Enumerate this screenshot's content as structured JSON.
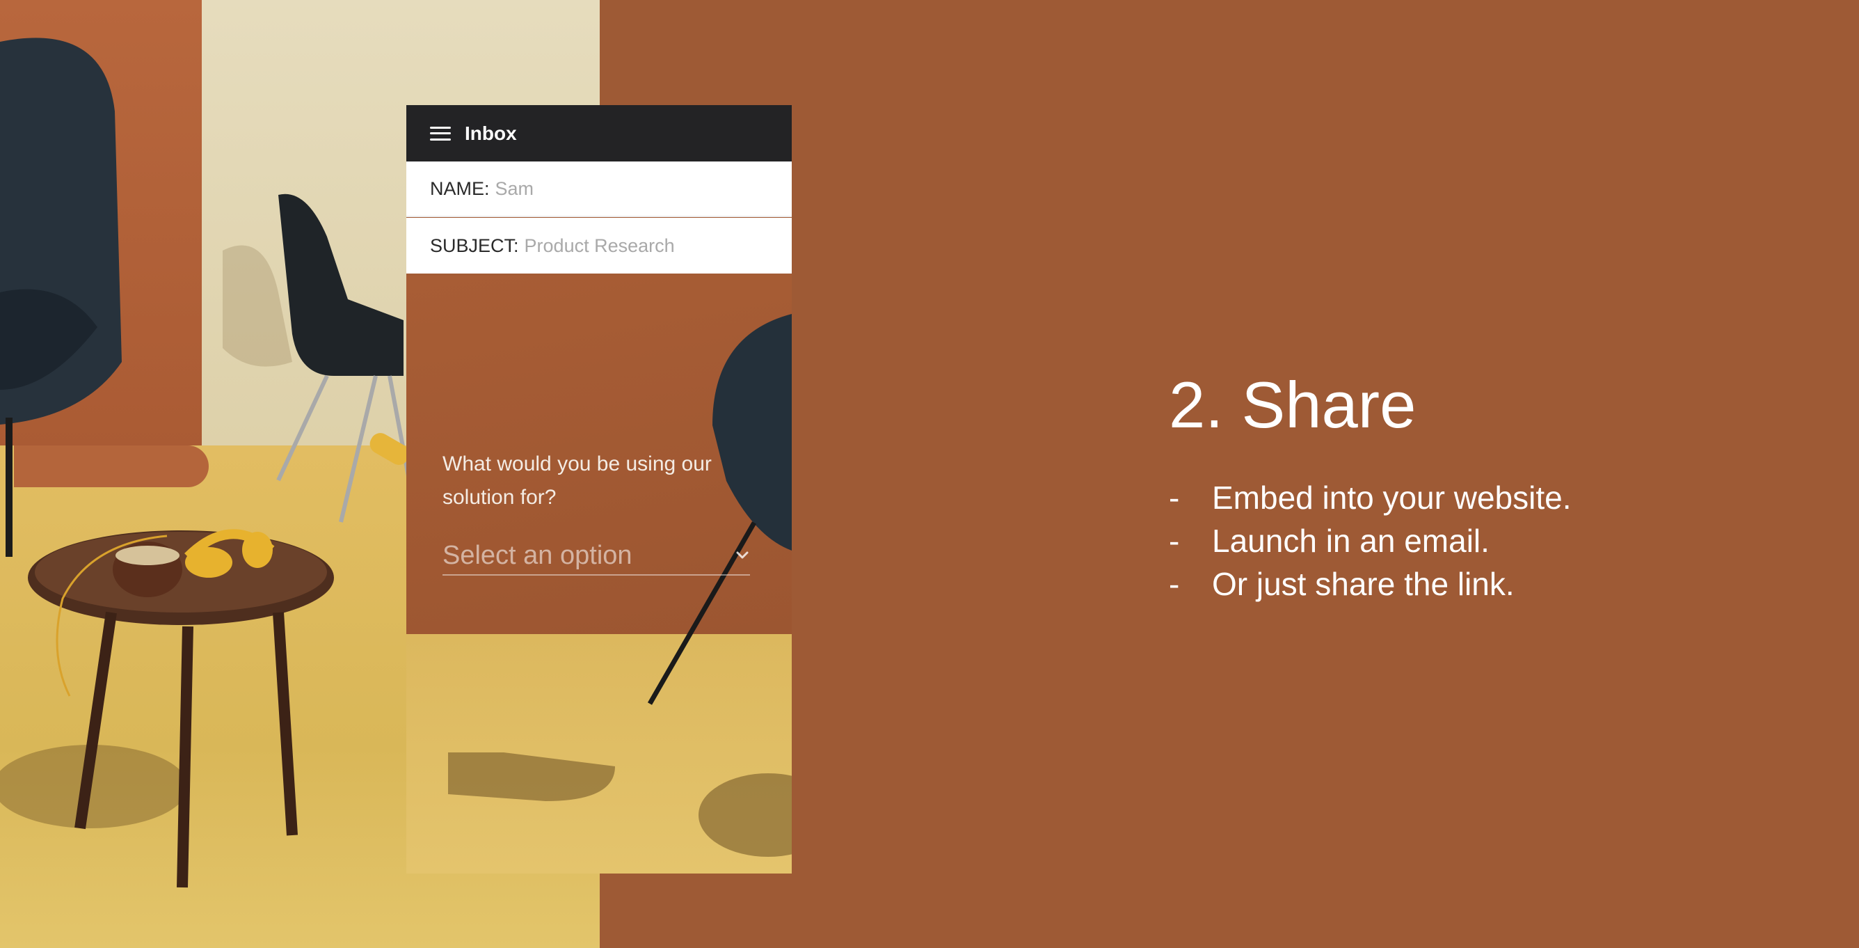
{
  "app": {
    "title": "Inbox",
    "menu_icon": "hamburger-menu-icon",
    "colors": {
      "appbar": "#232325",
      "background": "#9e5a35",
      "text_light": "#ffffff"
    }
  },
  "form": {
    "name_label": "NAME:",
    "name_value": "Sam",
    "subject_label": "SUBJECT:",
    "subject_value": "Product Research",
    "question": "What would you be using our solution for?",
    "select_placeholder": "Select an option",
    "select_icon": "chevron-down-icon"
  },
  "content": {
    "heading": "2. Share",
    "bullet_marker": "-",
    "bullets": [
      "Embed into your website.",
      "Launch in an email.",
      "Or just share the link."
    ]
  }
}
